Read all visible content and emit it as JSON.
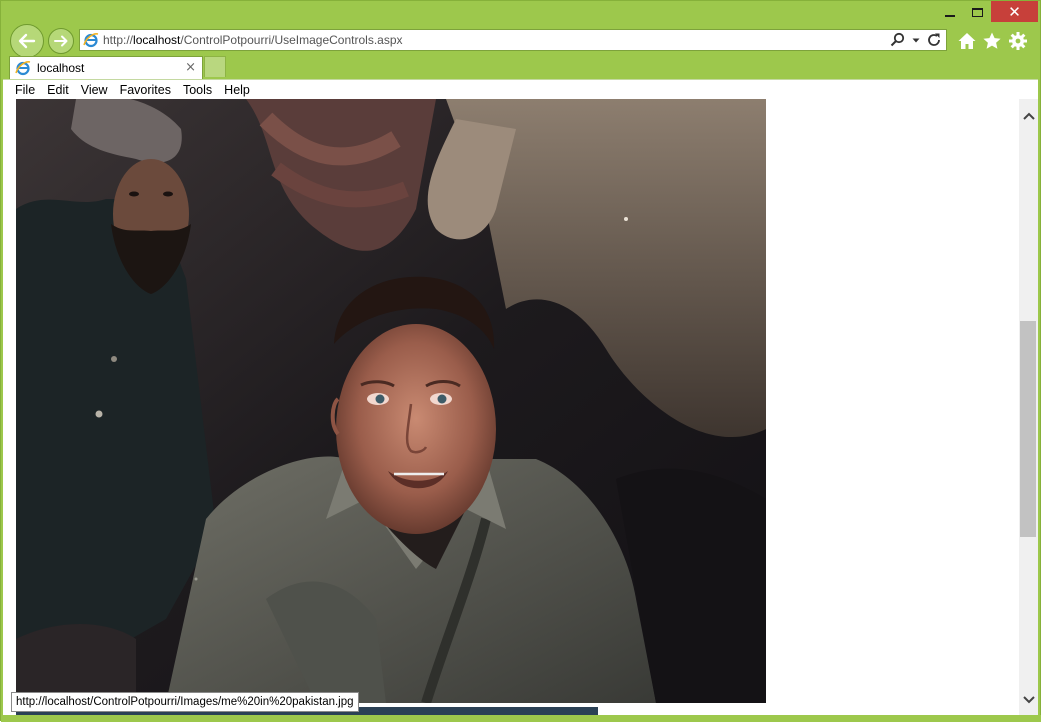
{
  "window": {
    "minimize_icon": "minimize-icon",
    "maximize_icon": "maximize-icon",
    "close_icon": "close-icon",
    "close_glyph": "✕",
    "accent": "#9dc84c",
    "close_color": "#c7403a"
  },
  "toolbar": {
    "back_icon": "back-arrow-icon",
    "forward_icon": "forward-arrow-icon",
    "home_icon": "home-icon",
    "favorites_icon": "star-icon",
    "tools_icon": "gear-icon"
  },
  "address": {
    "url_prefix": "http://",
    "url_host": "localhost",
    "url_path": "/ControlPotpourri/UseImageControls.aspx",
    "site_icon": "ie-logo-icon",
    "search_icon": "search-icon",
    "dropdown_icon": "chevron-down-icon",
    "refresh_icon": "refresh-icon"
  },
  "tabs": [
    {
      "label": "localhost",
      "close": "×",
      "icon": "ie-logo-icon"
    }
  ],
  "menu": {
    "items": [
      "File",
      "Edit",
      "View",
      "Favorites",
      "Tools",
      "Help"
    ]
  },
  "status": {
    "text": "http://localhost/ControlPotpourri/Images/me%20in%20pakistan.jpg"
  },
  "scrollbar": {
    "up_icon": "chevron-up-icon",
    "down_icon": "chevron-down-icon"
  }
}
